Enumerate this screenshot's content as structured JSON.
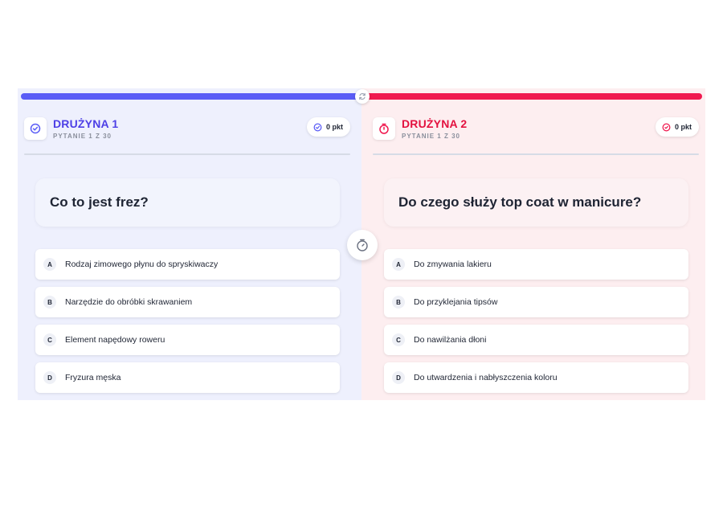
{
  "colors": {
    "team1": "#5a5cf6",
    "team2": "#f0194f",
    "team1_title": "#4d3fe6",
    "team2_title": "#e3113f"
  },
  "icons": {
    "team1": "check-circle-icon",
    "team2": "stopwatch-icon",
    "center": "stopwatch-icon",
    "sync": "refresh-icon",
    "score1": "check-circle-icon",
    "score2": "x-circle-icon"
  },
  "team1": {
    "name": "DRUŻYNA 1",
    "progress": "PYTANIE 1 Z 30",
    "score": "0 pkt",
    "question": "Co to jest frez?",
    "answers": [
      {
        "letter": "A",
        "text": "Rodzaj zimowego płynu do spryskiwaczy"
      },
      {
        "letter": "B",
        "text": "Narzędzie do obróbki skrawaniem"
      },
      {
        "letter": "C",
        "text": "Element napędowy roweru"
      },
      {
        "letter": "D",
        "text": "Fryzura męska"
      }
    ]
  },
  "team2": {
    "name": "DRUŻYNA 2",
    "progress": "PYTANIE 1 Z 30",
    "score": "0 pkt",
    "question": "Do czego służy top coat w manicure?",
    "answers": [
      {
        "letter": "A",
        "text": "Do zmywania lakieru"
      },
      {
        "letter": "B",
        "text": "Do przyklejania tipsów"
      },
      {
        "letter": "C",
        "text": "Do nawilżania dłoni"
      },
      {
        "letter": "D",
        "text": "Do utwardzenia i nabłyszczenia koloru"
      }
    ]
  }
}
